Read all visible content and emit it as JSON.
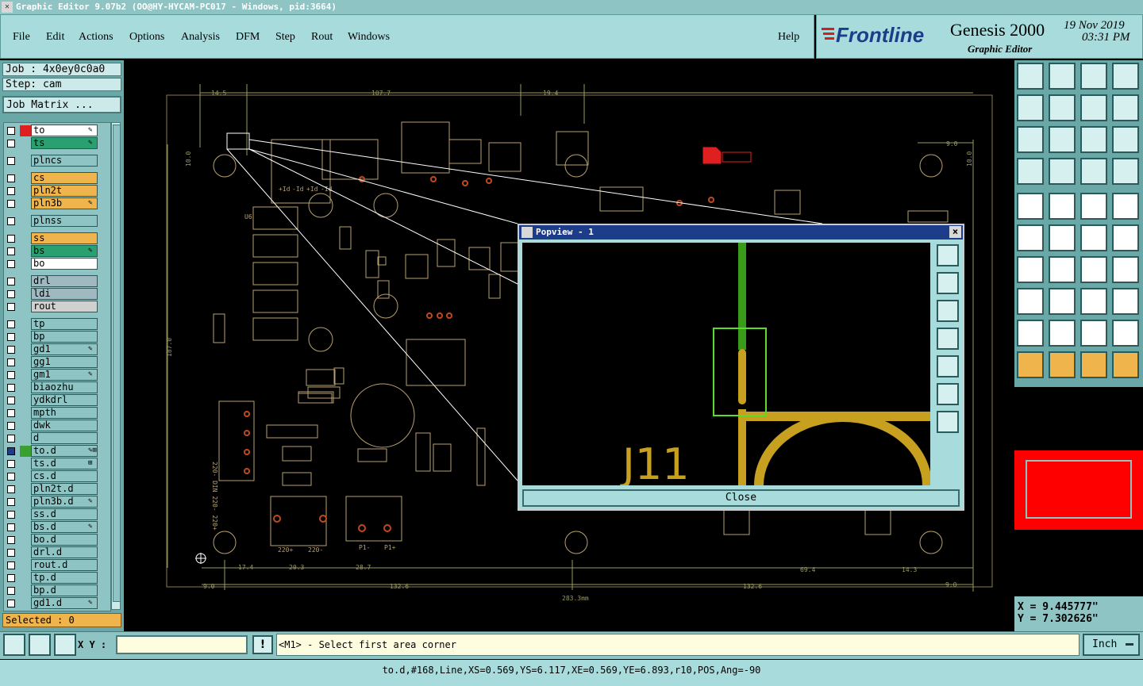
{
  "window": {
    "title": "Graphic Editor 9.07b2 (OO@HY-HYCAM-PC017 - Windows, pid:3664)"
  },
  "menu": {
    "items": [
      "File",
      "Edit",
      "Actions",
      "Options",
      "Analysis",
      "DFM",
      "Step",
      "Rout",
      "Windows"
    ],
    "help": "Help"
  },
  "brand": {
    "logo": "Frontline",
    "product": "Genesis 2000",
    "subtitle": "Graphic Editor",
    "date": "19 Nov 2019",
    "time": "03:31 PM"
  },
  "job": {
    "label": "Job : 4x0ey0c0a0",
    "step": "Step: cam",
    "matrix_button": "Job Matrix ..."
  },
  "layers": [
    {
      "name": "to",
      "color": "#ffffff",
      "swatch": "#e02020",
      "icon": "✎"
    },
    {
      "name": "ts",
      "color": "#2aa070",
      "icon": "✎"
    },
    {
      "name": "plncs",
      "color": "#8fc4c4",
      "gap": true
    },
    {
      "name": "cs",
      "color": "#f0b44c",
      "gap": true
    },
    {
      "name": "pln2t",
      "color": "#f0b44c"
    },
    {
      "name": "pln3b",
      "color": "#f0b44c",
      "icon": "✎"
    },
    {
      "name": "plnss",
      "color": "#8fc4c4",
      "gap": true
    },
    {
      "name": "ss",
      "color": "#f0b44c",
      "gap": true
    },
    {
      "name": "bs",
      "color": "#2aa070",
      "icon": "✎"
    },
    {
      "name": "bo",
      "color": "#ffffff"
    },
    {
      "name": "drl",
      "color": "#a0b8c0",
      "gap": true
    },
    {
      "name": "ldi",
      "color": "#a0b8c0"
    },
    {
      "name": "rout",
      "color": "#d0d0d0"
    },
    {
      "name": "tp",
      "color": "#8fc4c4",
      "gap": true
    },
    {
      "name": "bp",
      "color": "#8fc4c4"
    },
    {
      "name": "gd1",
      "color": "#8fc4c4",
      "icon": "✎"
    },
    {
      "name": "gg1",
      "color": "#8fc4c4"
    },
    {
      "name": "gm1",
      "color": "#8fc4c4",
      "icon": "✎"
    },
    {
      "name": "biaozhu",
      "color": "#8fc4c4"
    },
    {
      "name": "ydkdrl",
      "color": "#8fc4c4"
    },
    {
      "name": "mpth",
      "color": "#8fc4c4"
    },
    {
      "name": "dwk",
      "color": "#8fc4c4"
    },
    {
      "name": "d",
      "color": "#8fc4c4"
    },
    {
      "name": "to.d",
      "color": "#8fc4c4",
      "swatch": "#3aa030",
      "icon": "✎⊞",
      "active": true
    },
    {
      "name": "ts.d",
      "color": "#8fc4c4",
      "icon": "⊞"
    },
    {
      "name": "cs.d",
      "color": "#8fc4c4"
    },
    {
      "name": "pln2t.d",
      "color": "#8fc4c4"
    },
    {
      "name": "pln3b.d",
      "color": "#8fc4c4",
      "icon": "✎"
    },
    {
      "name": "ss.d",
      "color": "#8fc4c4"
    },
    {
      "name": "bs.d",
      "color": "#8fc4c4",
      "icon": "✎"
    },
    {
      "name": "bo.d",
      "color": "#8fc4c4"
    },
    {
      "name": "drl.d",
      "color": "#8fc4c4"
    },
    {
      "name": "rout.d",
      "color": "#8fc4c4"
    },
    {
      "name": "tp.d",
      "color": "#8fc4c4"
    },
    {
      "name": "bp.d",
      "color": "#8fc4c4"
    },
    {
      "name": "gd1.d",
      "color": "#8fc4c4",
      "icon": "✎"
    }
  ],
  "selected": "Selected : 0",
  "board": {
    "dims_top": [
      "14.5",
      "107.7",
      "19.4",
      "9.0"
    ],
    "dims_bottom": [
      "17.4",
      "20.3",
      "28.7",
      "69.4",
      "14.3",
      "9.0",
      "132.6",
      "132.6",
      "9.0",
      "283.3mm"
    ],
    "dim_left": "187.0",
    "dim_left_small": "10.0",
    "dim_right_small": "10.0",
    "labels": [
      "220- DIN 220- 220+",
      "220+",
      "220-",
      "P1-",
      "P1+"
    ],
    "silk": [
      "+Id",
      "-Id",
      "+Id",
      "-Id",
      "U6"
    ]
  },
  "popview": {
    "title": "Popview - 1",
    "close_label": "Close",
    "close_x": "×",
    "refdes": "J11"
  },
  "coord": {
    "x": "X = 9.445777\"",
    "y": "Y = 7.302626\""
  },
  "bottom": {
    "xy_label": "X Y :",
    "xy_value": "",
    "exclaim": "!",
    "prompt": "<M1> - Select first area corner",
    "units": "Inch"
  },
  "status": "to.d,#168,Line,XS=0.569,YS=6.117,XE=0.569,YE=6.893,r10,POS,Ang=-90"
}
